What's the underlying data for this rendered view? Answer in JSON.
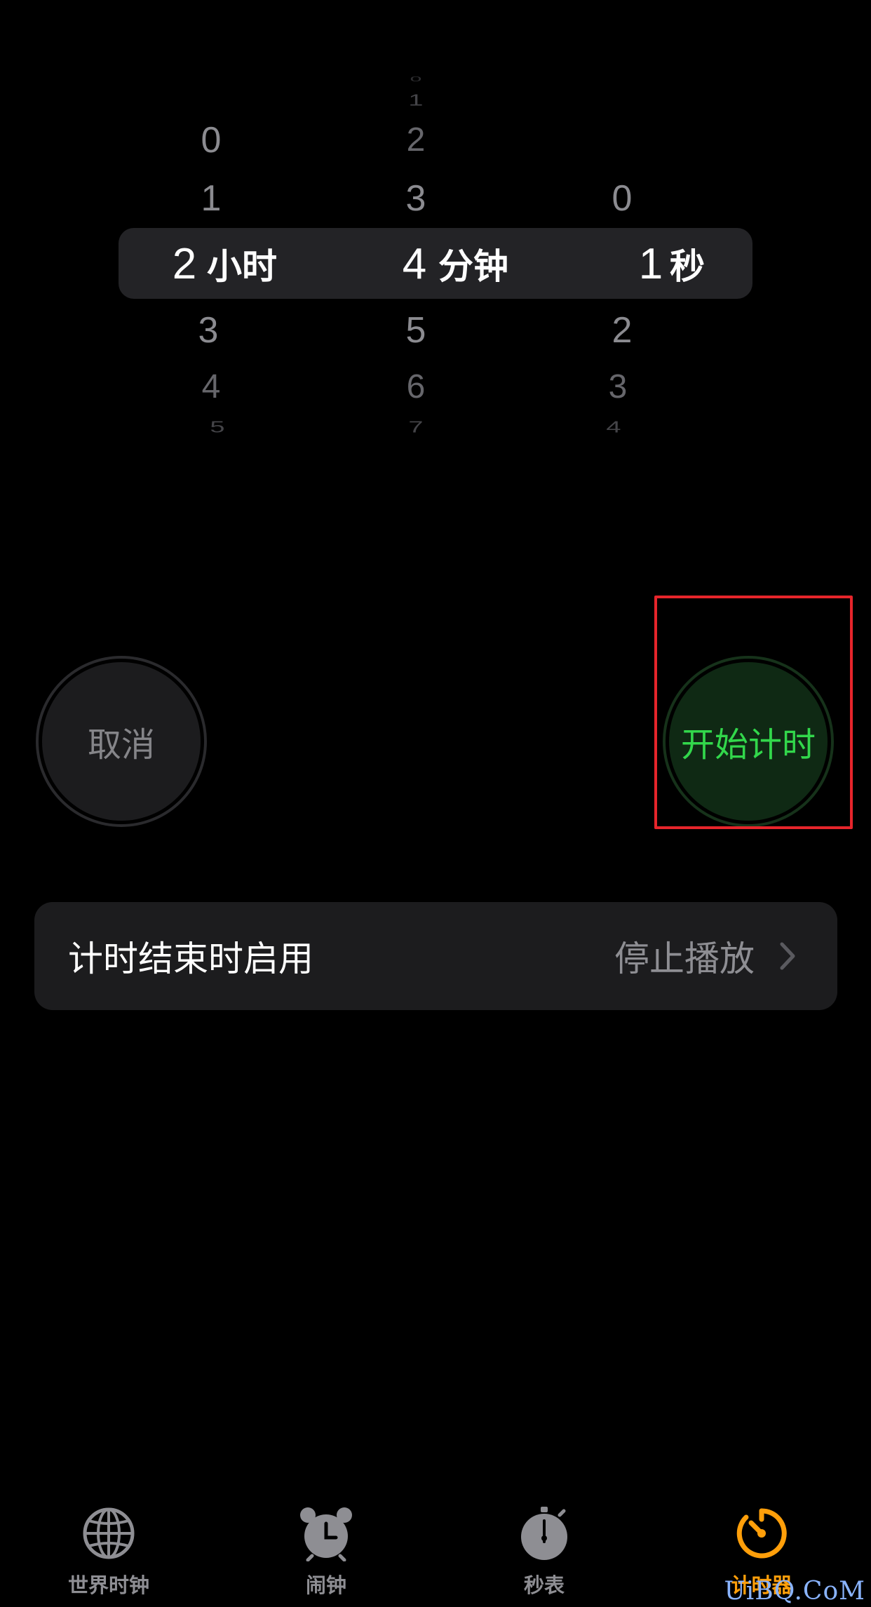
{
  "picker": {
    "hours": {
      "above": [
        "0",
        "1"
      ],
      "selected": "2",
      "unit": "小时",
      "below": [
        "3",
        "4",
        "5"
      ]
    },
    "minutes": {
      "above": [
        "0",
        "1",
        "2",
        "3"
      ],
      "selected": "4",
      "unit": "分钟",
      "below": [
        "5",
        "6",
        "7"
      ]
    },
    "seconds": {
      "above": [
        "0"
      ],
      "selected": "1",
      "unit": "秒",
      "below": [
        "2",
        "3",
        "4"
      ]
    }
  },
  "buttons": {
    "cancel_label": "取消",
    "start_label": "开始计时"
  },
  "settings": {
    "title": "计时结束时启用",
    "value": "停止播放"
  },
  "tabbar": {
    "tabs": [
      {
        "label": "世界时钟",
        "icon": "globe-icon",
        "active": false
      },
      {
        "label": "闹钟",
        "icon": "alarm-clock-icon",
        "active": false
      },
      {
        "label": "秒表",
        "icon": "stopwatch-icon",
        "active": false
      },
      {
        "label": "计时器",
        "icon": "timer-icon",
        "active": true
      }
    ]
  },
  "watermark": "UiBQ.CoM",
  "colors": {
    "accent_green": "#32d74b",
    "accent_orange": "#ff9f0a",
    "highlight_red": "#e6252b"
  }
}
